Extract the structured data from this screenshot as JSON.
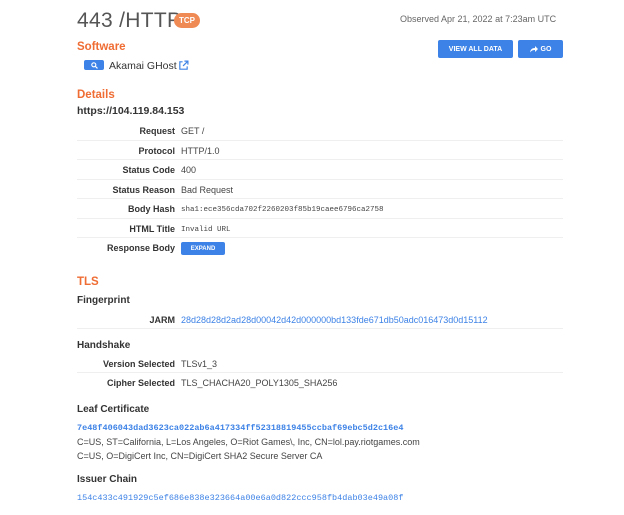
{
  "header": {
    "port": "443",
    "protocol": "HTTP",
    "transport_badge": "TCP",
    "observed": "Observed Apr 21, 2022 at 7:23am UTC"
  },
  "actions": {
    "view_all_label": "VIEW ALL DATA",
    "go_label": "GO",
    "go_icon": "share-arrow-icon"
  },
  "software": {
    "title": "Software",
    "name": "Akamai GHost",
    "search_icon": "search-icon",
    "link_icon": "external-link-icon"
  },
  "details": {
    "title": "Details",
    "url": "https://104.119.84.153",
    "rows": [
      {
        "label": "Request",
        "value": "GET /"
      },
      {
        "label": "Protocol",
        "value": "HTTP/1.0"
      },
      {
        "label": "Status Code",
        "value": "400"
      },
      {
        "label": "Status Reason",
        "value": "Bad Request"
      },
      {
        "label": "Body Hash",
        "value": "sha1:ece356cda702f2260203f85b19caee6796ca2758"
      },
      {
        "label": "HTML Title",
        "value": "Invalid URL"
      },
      {
        "label": "Response Body",
        "value": ""
      }
    ],
    "expand_label": "EXPAND"
  },
  "tls": {
    "title": "TLS",
    "fingerprint_title": "Fingerprint",
    "jarm_label": "JARM",
    "jarm_value": "28d28d28d2ad28d00042d42d000000bd133fde671db50adc016473d0d15112",
    "handshake_title": "Handshake",
    "version_label": "Version Selected",
    "version_value": "TLSv1_3",
    "cipher_label": "Cipher Selected",
    "cipher_value": "TLS_CHACHA20_POLY1305_SHA256",
    "leaf_title": "Leaf Certificate",
    "leaf_hash": "7e48f406043dad3623ca022ab6a417334ff52318819455ccbaf69ebc5d2c16e4",
    "leaf_subject": "C=US, ST=California, L=Los Angeles, O=Riot Games\\, Inc, CN=lol.pay.riotgames.com",
    "leaf_issuer": "C=US, O=DigiCert Inc, CN=DigiCert SHA2 Secure Server CA",
    "issuer_chain_title": "Issuer Chain",
    "issuer_chain_hash": "154c433c491929c5ef686e838e323664a00e6a0d822ccc958fb4dab03e49a08f"
  }
}
